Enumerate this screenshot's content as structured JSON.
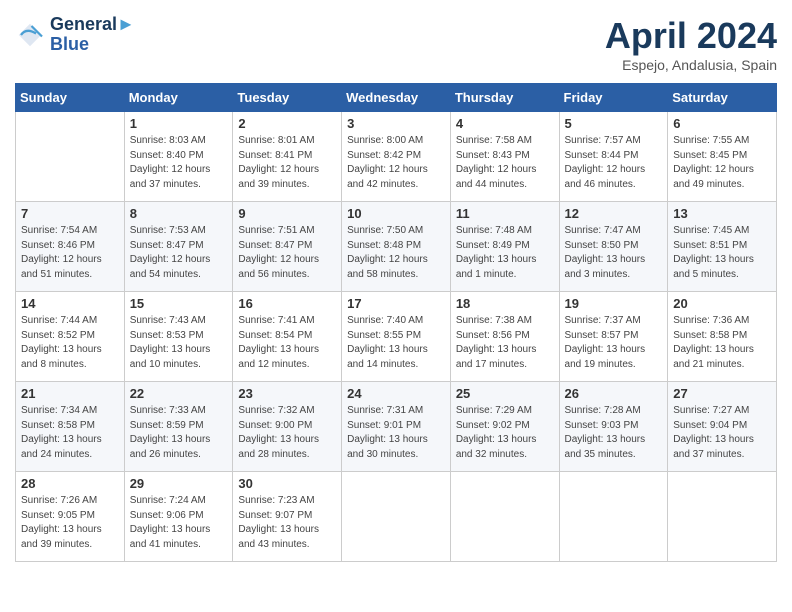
{
  "header": {
    "logo_line1": "General",
    "logo_line2": "Blue",
    "month_title": "April 2024",
    "location": "Espejo, Andalusia, Spain"
  },
  "days_of_week": [
    "Sunday",
    "Monday",
    "Tuesday",
    "Wednesday",
    "Thursday",
    "Friday",
    "Saturday"
  ],
  "weeks": [
    [
      {
        "day": "",
        "info": ""
      },
      {
        "day": "1",
        "info": "Sunrise: 8:03 AM\nSunset: 8:40 PM\nDaylight: 12 hours\nand 37 minutes."
      },
      {
        "day": "2",
        "info": "Sunrise: 8:01 AM\nSunset: 8:41 PM\nDaylight: 12 hours\nand 39 minutes."
      },
      {
        "day": "3",
        "info": "Sunrise: 8:00 AM\nSunset: 8:42 PM\nDaylight: 12 hours\nand 42 minutes."
      },
      {
        "day": "4",
        "info": "Sunrise: 7:58 AM\nSunset: 8:43 PM\nDaylight: 12 hours\nand 44 minutes."
      },
      {
        "day": "5",
        "info": "Sunrise: 7:57 AM\nSunset: 8:44 PM\nDaylight: 12 hours\nand 46 minutes."
      },
      {
        "day": "6",
        "info": "Sunrise: 7:55 AM\nSunset: 8:45 PM\nDaylight: 12 hours\nand 49 minutes."
      }
    ],
    [
      {
        "day": "7",
        "info": "Sunrise: 7:54 AM\nSunset: 8:46 PM\nDaylight: 12 hours\nand 51 minutes."
      },
      {
        "day": "8",
        "info": "Sunrise: 7:53 AM\nSunset: 8:47 PM\nDaylight: 12 hours\nand 54 minutes."
      },
      {
        "day": "9",
        "info": "Sunrise: 7:51 AM\nSunset: 8:47 PM\nDaylight: 12 hours\nand 56 minutes."
      },
      {
        "day": "10",
        "info": "Sunrise: 7:50 AM\nSunset: 8:48 PM\nDaylight: 12 hours\nand 58 minutes."
      },
      {
        "day": "11",
        "info": "Sunrise: 7:48 AM\nSunset: 8:49 PM\nDaylight: 13 hours\nand 1 minute."
      },
      {
        "day": "12",
        "info": "Sunrise: 7:47 AM\nSunset: 8:50 PM\nDaylight: 13 hours\nand 3 minutes."
      },
      {
        "day": "13",
        "info": "Sunrise: 7:45 AM\nSunset: 8:51 PM\nDaylight: 13 hours\nand 5 minutes."
      }
    ],
    [
      {
        "day": "14",
        "info": "Sunrise: 7:44 AM\nSunset: 8:52 PM\nDaylight: 13 hours\nand 8 minutes."
      },
      {
        "day": "15",
        "info": "Sunrise: 7:43 AM\nSunset: 8:53 PM\nDaylight: 13 hours\nand 10 minutes."
      },
      {
        "day": "16",
        "info": "Sunrise: 7:41 AM\nSunset: 8:54 PM\nDaylight: 13 hours\nand 12 minutes."
      },
      {
        "day": "17",
        "info": "Sunrise: 7:40 AM\nSunset: 8:55 PM\nDaylight: 13 hours\nand 14 minutes."
      },
      {
        "day": "18",
        "info": "Sunrise: 7:38 AM\nSunset: 8:56 PM\nDaylight: 13 hours\nand 17 minutes."
      },
      {
        "day": "19",
        "info": "Sunrise: 7:37 AM\nSunset: 8:57 PM\nDaylight: 13 hours\nand 19 minutes."
      },
      {
        "day": "20",
        "info": "Sunrise: 7:36 AM\nSunset: 8:58 PM\nDaylight: 13 hours\nand 21 minutes."
      }
    ],
    [
      {
        "day": "21",
        "info": "Sunrise: 7:34 AM\nSunset: 8:58 PM\nDaylight: 13 hours\nand 24 minutes."
      },
      {
        "day": "22",
        "info": "Sunrise: 7:33 AM\nSunset: 8:59 PM\nDaylight: 13 hours\nand 26 minutes."
      },
      {
        "day": "23",
        "info": "Sunrise: 7:32 AM\nSunset: 9:00 PM\nDaylight: 13 hours\nand 28 minutes."
      },
      {
        "day": "24",
        "info": "Sunrise: 7:31 AM\nSunset: 9:01 PM\nDaylight: 13 hours\nand 30 minutes."
      },
      {
        "day": "25",
        "info": "Sunrise: 7:29 AM\nSunset: 9:02 PM\nDaylight: 13 hours\nand 32 minutes."
      },
      {
        "day": "26",
        "info": "Sunrise: 7:28 AM\nSunset: 9:03 PM\nDaylight: 13 hours\nand 35 minutes."
      },
      {
        "day": "27",
        "info": "Sunrise: 7:27 AM\nSunset: 9:04 PM\nDaylight: 13 hours\nand 37 minutes."
      }
    ],
    [
      {
        "day": "28",
        "info": "Sunrise: 7:26 AM\nSunset: 9:05 PM\nDaylight: 13 hours\nand 39 minutes."
      },
      {
        "day": "29",
        "info": "Sunrise: 7:24 AM\nSunset: 9:06 PM\nDaylight: 13 hours\nand 41 minutes."
      },
      {
        "day": "30",
        "info": "Sunrise: 7:23 AM\nSunset: 9:07 PM\nDaylight: 13 hours\nand 43 minutes."
      },
      {
        "day": "",
        "info": ""
      },
      {
        "day": "",
        "info": ""
      },
      {
        "day": "",
        "info": ""
      },
      {
        "day": "",
        "info": ""
      }
    ]
  ]
}
